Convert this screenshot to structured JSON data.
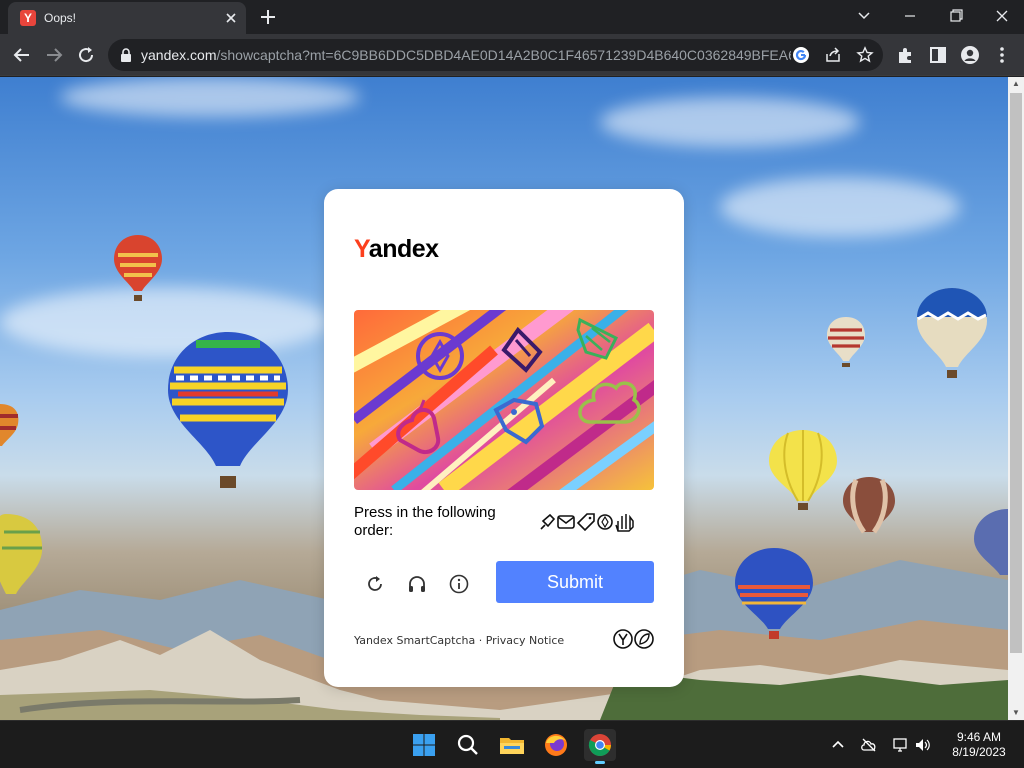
{
  "browser": {
    "tab": {
      "title": "Oops!",
      "favicon_letter": "Y"
    },
    "address": {
      "host": "yandex.com",
      "path": "/showcaptcha?mt=6C9BB6DDC5DBD4AE0D14A2B0C1F46571239D4B640C0362849BFEA65..."
    }
  },
  "captcha": {
    "logo_first": "Y",
    "logo_rest": "andex",
    "prompt": "Press in the following order:",
    "order_icons": [
      "comet-icon",
      "envelope-icon",
      "tag-icon",
      "compass-icon",
      "hand-icon"
    ],
    "submit_label": "Submit",
    "footer_brand": "Yandex SmartCaptcha",
    "footer_sep": "·",
    "footer_privacy": "Privacy Notice",
    "accent": "#5282ff",
    "logo_red": "#fc3f1d"
  },
  "taskbar": {
    "time": "9:46 AM",
    "date": "8/19/2023",
    "apps": [
      "start-icon",
      "search-icon",
      "file-explorer-icon",
      "firefox-icon",
      "chrome-icon"
    ]
  }
}
